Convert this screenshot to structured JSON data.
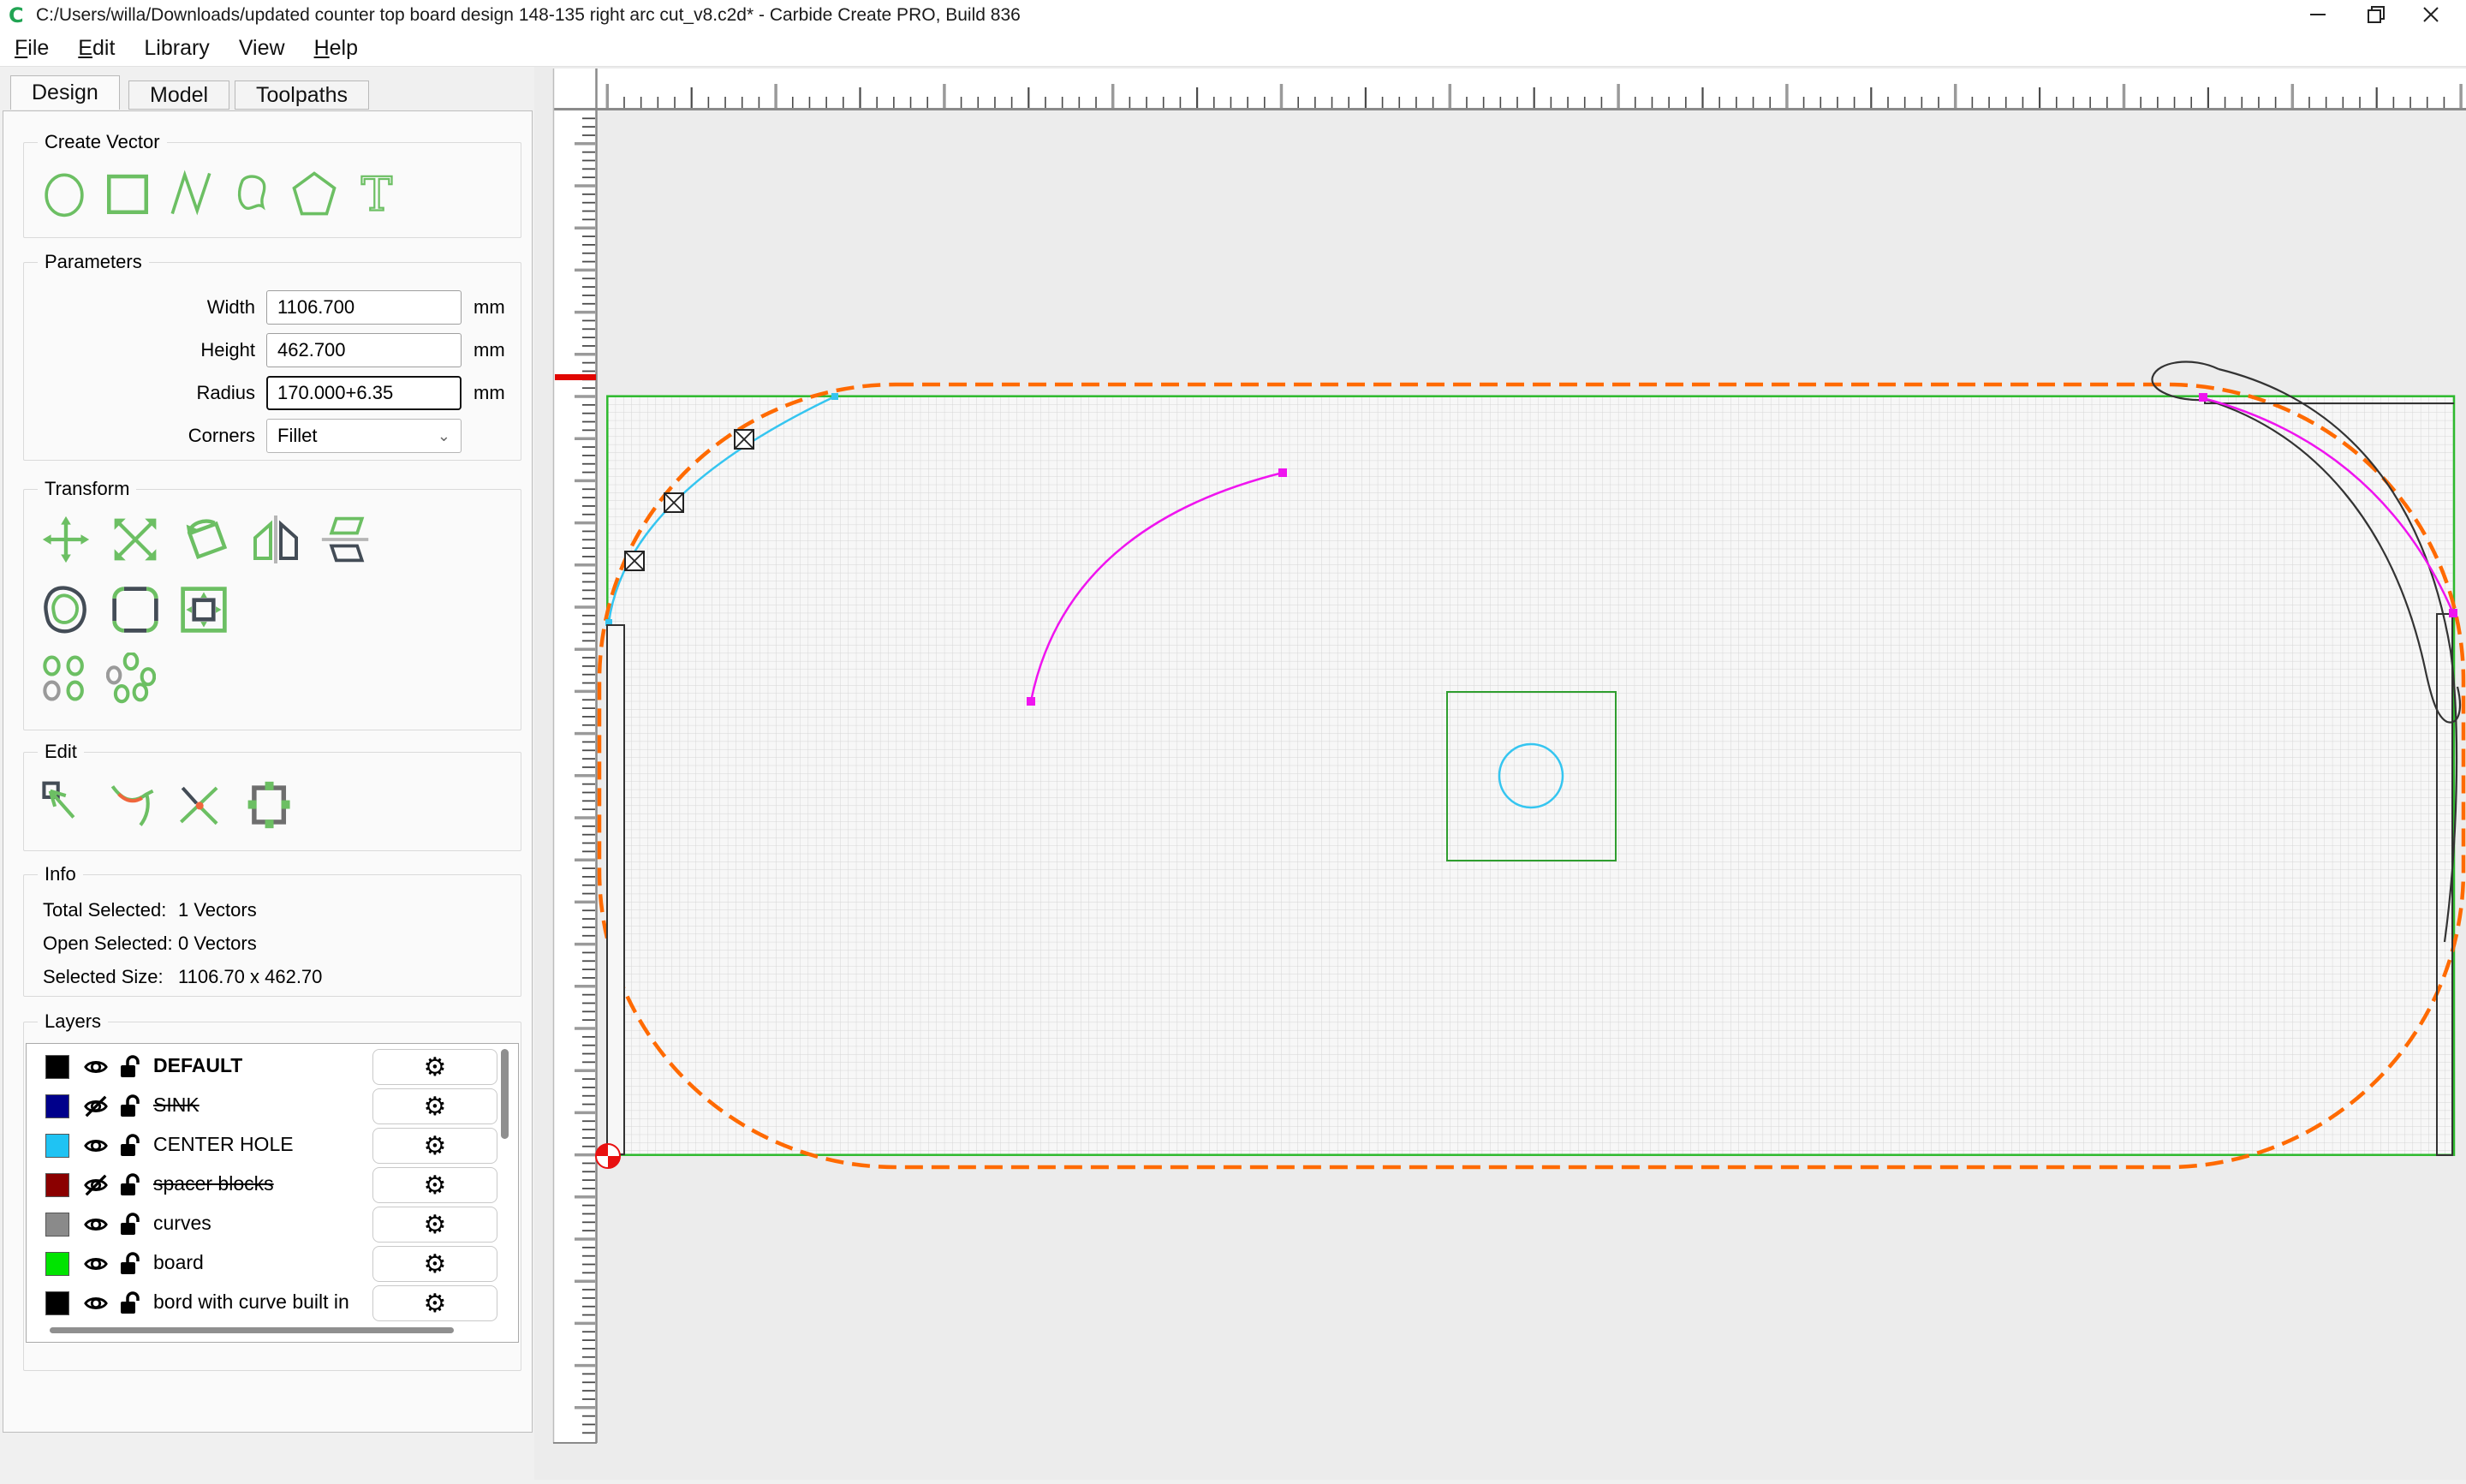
{
  "window": {
    "title": "C:/Users/willa/Downloads/updated counter top board design 148-135 right arc cut_v8.c2d* - Carbide Create PRO, Build 836",
    "app_icon_glyph": "C"
  },
  "menu": {
    "items": [
      {
        "label": "File",
        "mnemonic_underline": true
      },
      {
        "label": "Edit",
        "mnemonic_underline": true
      },
      {
        "label": "Library",
        "mnemonic_underline": false
      },
      {
        "label": "View",
        "mnemonic_underline": false
      },
      {
        "label": "Help",
        "mnemonic_underline": true
      }
    ]
  },
  "tabs": [
    {
      "label": "Design",
      "active": true
    },
    {
      "label": "Model",
      "active": false
    },
    {
      "label": "Toolpaths",
      "active": false
    }
  ],
  "create_vector": {
    "title": "Create Vector",
    "icons": [
      "circle-tool-icon",
      "rectangle-tool-icon",
      "polyline-tool-icon",
      "curve-tool-icon",
      "polygon-tool-icon",
      "text-tool-icon"
    ]
  },
  "parameters": {
    "title": "Parameters",
    "fields": [
      {
        "label": "Width",
        "value": "1106.700",
        "unit": "mm",
        "type": "text",
        "focused": false
      },
      {
        "label": "Height",
        "value": "462.700",
        "unit": "mm",
        "type": "text",
        "focused": false
      },
      {
        "label": "Radius",
        "value": "170.000+6.35",
        "unit": "mm",
        "type": "text",
        "focused": true
      },
      {
        "label": "Corners",
        "value": "Fillet",
        "unit": "",
        "type": "select",
        "focused": false
      }
    ]
  },
  "transform": {
    "title": "Transform",
    "icon_rows": [
      [
        "move-icon",
        "scale-icon",
        "rotate-icon",
        "mirror-icon",
        "flip-vertical-icon"
      ],
      [
        "offset-icon",
        "round-corners-icon",
        "fit-inside-icon"
      ],
      [
        "grid-copy-icon",
        "circular-copy-icon"
      ]
    ]
  },
  "edit": {
    "title": "Edit",
    "icons": [
      "node-edit-icon",
      "trim-icon",
      "break-curve-icon",
      "resize-handles-icon"
    ]
  },
  "info": {
    "title": "Info",
    "rows": [
      {
        "label": "Total Selected:",
        "value": "1 Vectors"
      },
      {
        "label": "Open Selected:",
        "value": "0 Vectors"
      },
      {
        "label": "Selected Size:",
        "value": "1106.70 x 462.70"
      }
    ]
  },
  "layers": {
    "title": "Layers",
    "items": [
      {
        "name": "DEFAULT",
        "color": "#000000",
        "visible": true,
        "bold": true,
        "strikethrough": false
      },
      {
        "name": "SINK",
        "color": "#00008b",
        "visible": false,
        "bold": false,
        "strikethrough": true
      },
      {
        "name": "CENTER HOLE",
        "color": "#1fc3f3",
        "visible": true,
        "bold": false,
        "strikethrough": false
      },
      {
        "name": "spacer blocks",
        "color": "#8b0000",
        "visible": false,
        "bold": false,
        "strikethrough": true
      },
      {
        "name": "curves",
        "color": "#8a8a8a",
        "visible": true,
        "bold": false,
        "strikethrough": false
      },
      {
        "name": "board",
        "color": "#00e400",
        "visible": true,
        "bold": false,
        "strikethrough": false
      },
      {
        "name": "bord with curve built in",
        "color": "#000000",
        "visible": true,
        "bold": false,
        "strikethrough": false
      }
    ]
  },
  "canvas": {
    "colors": {
      "background": "#ececec",
      "ruler_bg": "#ffffff",
      "ruler_line": "#8a8a8a",
      "tick_dark": "#4a4a4a",
      "tick_gray": "#9a9a9a",
      "ruler_red_mark": "#e10600",
      "grid_line": "#d6d6d6",
      "board_green": "#2db92d",
      "selection_orange": "#ff6a00",
      "center_hole_cyan": "#35c5f0",
      "curve_magenta": "#ef14ef",
      "vector_black": "#333333",
      "origin_red": "#e81010"
    },
    "ui_green": "#6cbf63",
    "ui_dark": "#434c56",
    "ui_orange": "#f0663c",
    "ui_gray": "#9a9a9a"
  }
}
